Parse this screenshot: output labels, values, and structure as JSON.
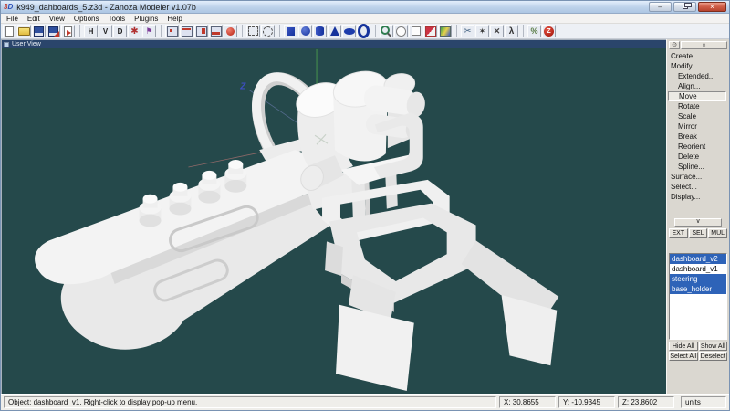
{
  "window": {
    "logo_3": "3",
    "logo_d": "D",
    "title": "k949_dahboards_5.z3d - Zanoza Modeler v1.07b",
    "minimize_glyph": "–",
    "close_glyph": "×"
  },
  "menubar": {
    "items": [
      {
        "name": "menu-file",
        "label": "File"
      },
      {
        "name": "menu-edit",
        "label": "Edit"
      },
      {
        "name": "menu-view",
        "label": "View"
      },
      {
        "name": "menu-options",
        "label": "Options"
      },
      {
        "name": "menu-tools",
        "label": "Tools"
      },
      {
        "name": "menu-plugins",
        "label": "Plugins"
      },
      {
        "name": "menu-help",
        "label": "Help"
      }
    ]
  },
  "toolbar": {
    "icons": [
      {
        "name": "new-file-icon",
        "icon": "new"
      },
      {
        "name": "open-file-icon",
        "icon": "open"
      },
      {
        "name": "save-file-icon",
        "icon": "save"
      },
      {
        "name": "save-as-icon",
        "icon": "saveas"
      },
      {
        "name": "export-icon",
        "icon": "export"
      },
      {
        "name": "h-view-button",
        "icon": "txt",
        "glyph": "H",
        "sep": true
      },
      {
        "name": "v-view-button",
        "icon": "txt",
        "glyph": "V"
      },
      {
        "name": "d-view-button",
        "icon": "txt",
        "glyph": "D"
      },
      {
        "name": "delete-star-icon",
        "icon": "star"
      },
      {
        "name": "flag-icon",
        "icon": "flag"
      },
      {
        "name": "vertices-mode-icon",
        "icon": "vc1",
        "sep": true
      },
      {
        "name": "edges-mode-icon",
        "icon": "vc2"
      },
      {
        "name": "faces-mode-icon",
        "icon": "vc3"
      },
      {
        "name": "objects-mode-icon",
        "icon": "vc4"
      },
      {
        "name": "render-sphere-icon",
        "icon": "redsphere"
      },
      {
        "name": "select-rectangle-icon",
        "icon": "selrect",
        "sep": true
      },
      {
        "name": "select-circle-icon",
        "icon": "selcirc"
      },
      {
        "name": "primitive-cube-icon",
        "icon": "pcube",
        "sep": true
      },
      {
        "name": "primitive-sphere-icon",
        "icon": "psphere"
      },
      {
        "name": "primitive-cylinder-icon",
        "icon": "pcyl"
      },
      {
        "name": "primitive-cone-icon",
        "icon": "pcone"
      },
      {
        "name": "primitive-ellipsoid-icon",
        "icon": "pellip"
      },
      {
        "name": "primitive-torus-icon",
        "icon": "ptorus"
      },
      {
        "name": "zoom-icon",
        "icon": "zoom",
        "sep": true
      },
      {
        "name": "wire-sphere-icon",
        "icon": "wsphere"
      },
      {
        "name": "wire-cube-icon",
        "icon": "wcube"
      },
      {
        "name": "texture-icon",
        "icon": "texture"
      },
      {
        "name": "render-view-icon",
        "icon": "render"
      },
      {
        "name": "scissors-icon",
        "icon": "scissors",
        "sep": true
      },
      {
        "name": "star-tool-icon",
        "icon": "star2"
      },
      {
        "name": "attach-icon",
        "icon": "attach"
      },
      {
        "name": "person-icon",
        "icon": "person"
      },
      {
        "name": "material-badge-icon",
        "icon": "badge",
        "sep": true
      },
      {
        "name": "zanoza-logo-icon",
        "icon": "zlogo",
        "glyph": "Z"
      }
    ]
  },
  "viewport": {
    "label": "User View",
    "background_color": "#25494b",
    "model_color": "#f1f1f1",
    "axis_z_label": "Z",
    "axis_colors": {
      "green": "#4ea04e",
      "blue": "#7381b8",
      "red": "#c87a78"
    }
  },
  "right_panel": {
    "rollup_icon_glyph": "⊙",
    "rollup_arch_glyph": "∩",
    "collapse_glyph": "∨",
    "menu_items": [
      {
        "name": "panel-item-create",
        "label": "Create..."
      },
      {
        "name": "panel-item-modify",
        "label": "Modify..."
      },
      {
        "name": "panel-item-extended",
        "label": "Extended...",
        "indent": true
      },
      {
        "name": "panel-item-align",
        "label": "Align...",
        "indent": true
      },
      {
        "name": "panel-item-move",
        "label": "Move",
        "indent": true,
        "pressed": true
      },
      {
        "name": "panel-item-rotate",
        "label": "Rotate",
        "indent": true
      },
      {
        "name": "panel-item-scale",
        "label": "Scale",
        "indent": true
      },
      {
        "name": "panel-item-mirror",
        "label": "Mirror",
        "indent": true
      },
      {
        "name": "panel-item-break",
        "label": "Break",
        "indent": true
      },
      {
        "name": "panel-item-reorient",
        "label": "Reorient",
        "indent": true
      },
      {
        "name": "panel-item-delete",
        "label": "Delete",
        "indent": true
      },
      {
        "name": "panel-item-spline",
        "label": "Spline...",
        "indent": true
      },
      {
        "name": "panel-item-surface",
        "label": "Surface..."
      },
      {
        "name": "panel-item-select",
        "label": "Select..."
      },
      {
        "name": "panel-item-display",
        "label": "Display..."
      }
    ],
    "mode_buttons": [
      {
        "name": "ext-button",
        "label": "EXT"
      },
      {
        "name": "sel-button",
        "label": "SEL"
      },
      {
        "name": "mul-button",
        "label": "MUL"
      }
    ],
    "objects": [
      {
        "name": "object-item-dashboard-v2",
        "label": "dashboard_v2",
        "selected": true
      },
      {
        "name": "object-item-dashboard-v1",
        "label": "dashboard_v1"
      },
      {
        "name": "object-item-steering",
        "label": "steering",
        "selected": true
      },
      {
        "name": "object-item-base-holder",
        "label": "base_holder",
        "selected": true
      }
    ],
    "list_buttons": [
      {
        "name": "hide-all-button",
        "label": "Hide All"
      },
      {
        "name": "show-all-button",
        "label": "Show All"
      },
      {
        "name": "select-all-button",
        "label": "Select All"
      },
      {
        "name": "deselect-button",
        "label": "Deselect"
      }
    ]
  },
  "statusbar": {
    "message": "Object: dashboard_v1. Right-click to display pop-up menu.",
    "x": "X: 30.8655",
    "y": "Y: -10.9345",
    "z": "Z: 23.8602",
    "units": "units"
  }
}
